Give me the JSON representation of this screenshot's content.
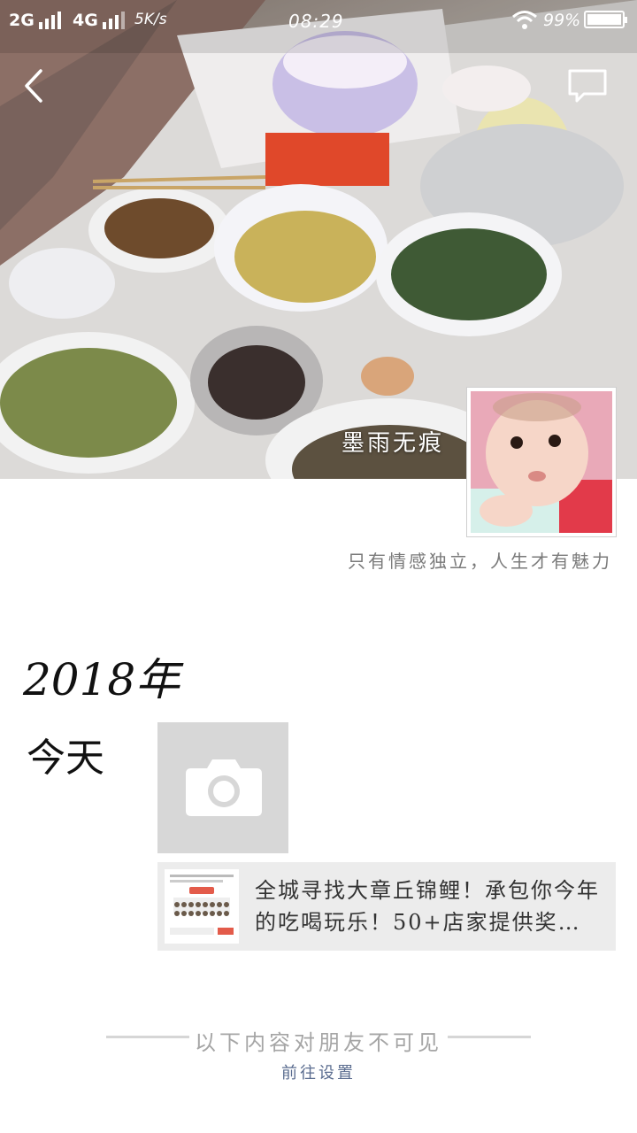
{
  "status_bar": {
    "network_1": "2G",
    "network_2": "4G",
    "speed": "5K/s",
    "time": "08:29",
    "battery_percent": "99%",
    "battery_level": 0.99,
    "icons": [
      "signal-bars-icon",
      "wifi-icon",
      "battery-icon"
    ]
  },
  "header": {
    "back_icon": "chevron-left-icon",
    "comment_icon": "message-bubble-icon"
  },
  "profile": {
    "username": "墨雨无痕",
    "signature": "只有情感独立，人生才有魅力"
  },
  "timeline": {
    "year": "2018年",
    "day_label": "今天",
    "camera_icon": "camera-icon",
    "share": {
      "text": "全城寻找大章丘锦鲤！承包你今年的吃喝玩乐！50+店家提供奖…"
    }
  },
  "footer": {
    "hidden_note": "以下内容对朋友不可见",
    "settings_link": "前往设置"
  },
  "colors": {
    "link": "#5a6c8f",
    "card_bg": "#ececec",
    "camera_tile_bg": "#d7d7d7"
  }
}
